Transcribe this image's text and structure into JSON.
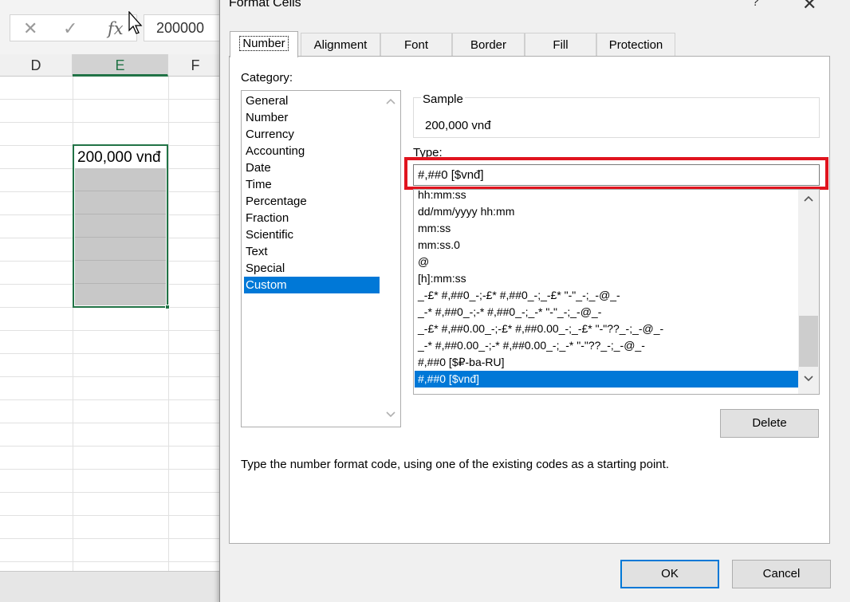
{
  "excel": {
    "formula_bar": {
      "cancel_icon": "✕",
      "enter_icon": "✓",
      "fx_icon": "fx",
      "value": "200000"
    },
    "columns": [
      "D",
      "E",
      "F"
    ],
    "active_cell_value": "200,000 vnđ",
    "accent_color": "#217346"
  },
  "dialog": {
    "title": "Format Cells",
    "help_label": "?",
    "close_label": "✕",
    "tabs": [
      {
        "label": "Number",
        "active": true
      },
      {
        "label": "Alignment",
        "active": false
      },
      {
        "label": "Font",
        "active": false
      },
      {
        "label": "Border",
        "active": false
      },
      {
        "label": "Fill",
        "active": false
      },
      {
        "label": "Protection",
        "active": false
      }
    ],
    "category_label": "Category:",
    "categories": [
      "General",
      "Number",
      "Currency",
      "Accounting",
      "Date",
      "Time",
      "Percentage",
      "Fraction",
      "Scientific",
      "Text",
      "Special",
      "Custom"
    ],
    "selected_category": "Custom",
    "sample_label": "Sample",
    "sample_value": "200,000 vnđ",
    "type_label": "Type:",
    "type_value": "#,##0 [$vnđ]",
    "type_list": [
      "hh:mm:ss",
      "dd/mm/yyyy hh:mm",
      "mm:ss",
      "mm:ss.0",
      "@",
      "[h]:mm:ss",
      "_-£* #,##0_-;-£* #,##0_-;_-£* \"-\"_-;_-@_-",
      "_-* #,##0_-;-* #,##0_-;_-* \"-\"_-;_-@_-",
      "_-£* #,##0.00_-;-£* #,##0.00_-;_-£* \"-\"??_-;_-@_-",
      "_-* #,##0.00_-;-* #,##0.00_-;_-* \"-\"??_-;_-@_-",
      "#,##0 [$₽-ba-RU]",
      "#,##0 [$vnđ]"
    ],
    "selected_type": "#,##0 [$vnđ]",
    "delete_label": "Delete",
    "hint": "Type the number format code, using one of the existing codes as a starting point.",
    "ok_label": "OK",
    "cancel_label": "Cancel",
    "selection_color": "#0078d7",
    "highlight_color": "#e0141e"
  }
}
